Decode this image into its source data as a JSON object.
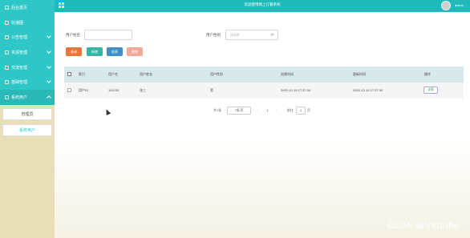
{
  "sidebar": {
    "items": [
      {
        "label": "后台首页",
        "active": false
      },
      {
        "label": "轮播图",
        "active": false
      },
      {
        "label": "公告管理",
        "active": false
      },
      {
        "label": "资源管理",
        "active": false
      },
      {
        "label": "交流管理",
        "active": false
      },
      {
        "label": "基础管理",
        "active": false
      },
      {
        "label": "系统用户",
        "active": true
      }
    ],
    "sub_items": [
      {
        "label": "管理员"
      },
      {
        "label": "系统用户"
      }
    ]
  },
  "header": {
    "title": "欢迎使用网上订餐系统",
    "user": "admin"
  },
  "search": {
    "username_label": "用户姓名",
    "username_value": "",
    "gender_label": "用户性别",
    "gender_placeholder": "请选择"
  },
  "buttons": {
    "query": "查询",
    "add": "新增",
    "report": "报表",
    "delete": "删除"
  },
  "colors": {
    "header_bg": "#1fb9b9",
    "sidebar_bg": "#2ec6c6",
    "query_btn": "#e9773a",
    "add_btn": "#35b5a5",
    "report_btn": "#3f8fc6",
    "delete_btn": "#f3a99a"
  },
  "table": {
    "columns": [
      "索引",
      "用户名",
      "用户姓名",
      "用户性别",
      "创建时间",
      "更新时间",
      "操作"
    ],
    "rows": [
      {
        "index": "用户01",
        "username": "112233",
        "name": "张三",
        "gender": "男",
        "created": "2022-12-19 17:37:34",
        "updated": "2022-12-19 17:37:34",
        "action": "详情"
      }
    ]
  },
  "pager": {
    "total": "共1条",
    "page_size": "7条/页",
    "current_page": "1",
    "goto_label": "前往",
    "goto_value": "1",
    "page_suffix": "页"
  },
  "watermark": "CSDN @VXbishe"
}
